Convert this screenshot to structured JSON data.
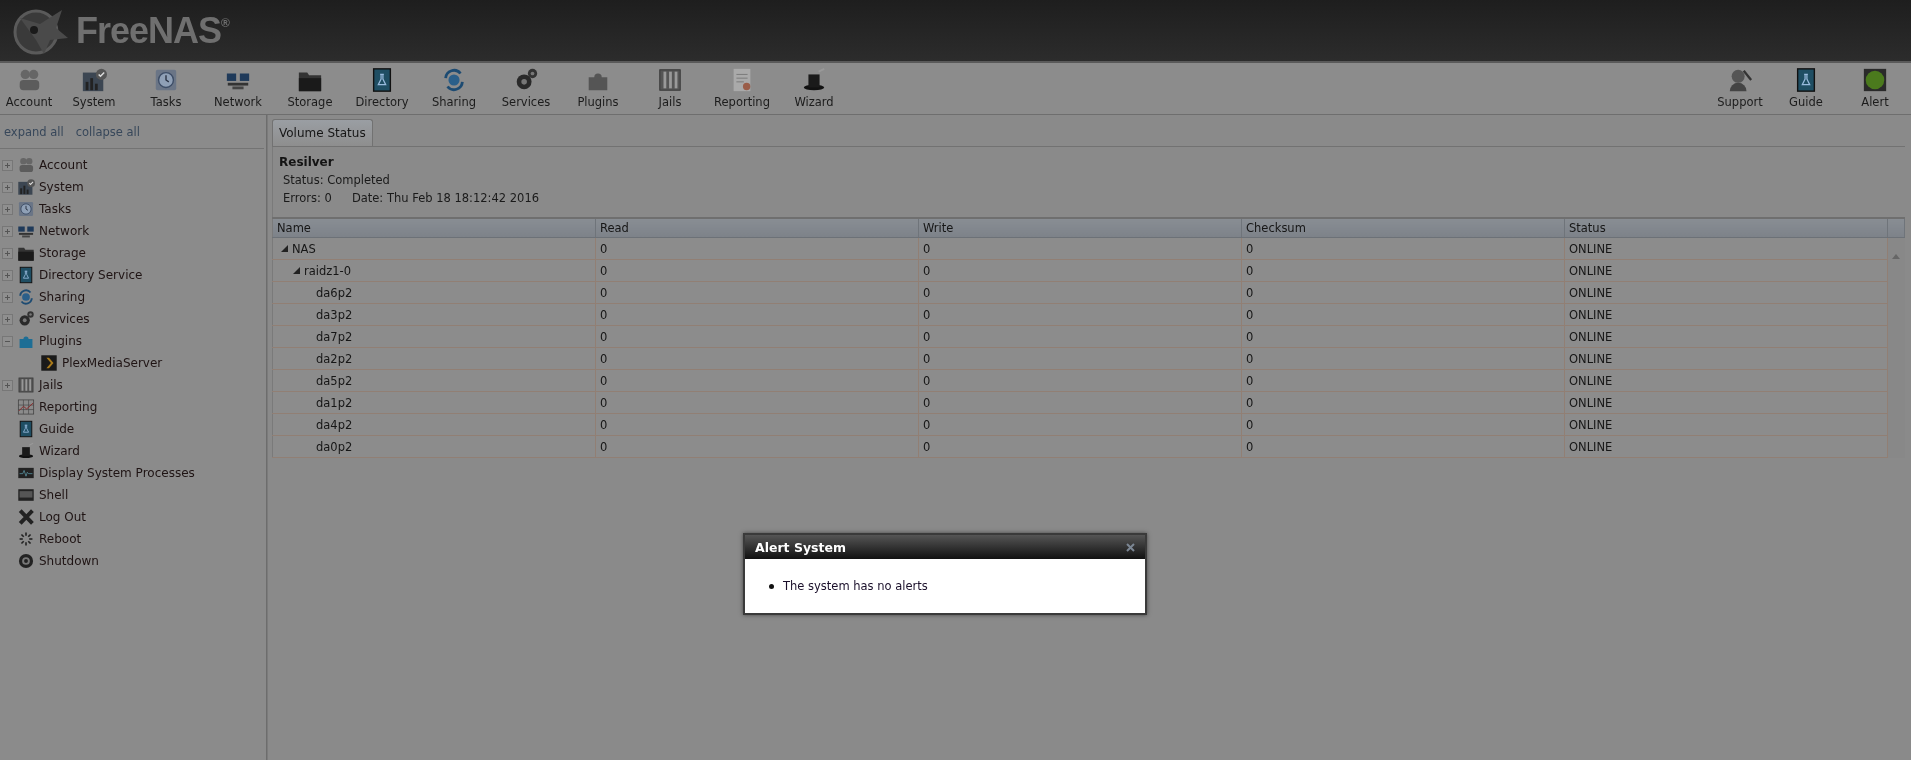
{
  "header": {
    "logo": "FreeNAS$^{®}$"
  },
  "toolbar": {
    "left": [
      "Account",
      "System",
      "Tasks",
      "Network",
      "Storage",
      "Directory",
      "Sharing",
      "Services",
      "Plugins",
      "Jails",
      "Reporting",
      "Wizard"
    ],
    "right": [
      "Support",
      "Guide",
      "Alert"
    ]
  },
  "sidebar": {
    "links": [
      "expand all",
      "collapse all"
    ],
    "items": [
      {
        "label": "Account",
        "expanded": false
      },
      {
        "label": "System",
        "expanded": false
      },
      {
        "label": "Tasks",
        "expanded": false
      },
      {
        "label": "Network",
        "expanded": false
      },
      {
        "label": "Storage",
        "expanded": false
      },
      {
        "label": "Directory Service",
        "expanded": false
      },
      {
        "label": "Sharing",
        "expanded": false
      },
      {
        "label": "Services",
        "expanded": false
      },
      {
        "label": "Plugins",
        "expanded": true,
        "children": [
          {
            "label": "PlexMediaServer"
          }
        ]
      },
      {
        "label": "Jails",
        "expanded": false
      },
      {
        "label": "Reporting"
      },
      {
        "label": "Guide"
      },
      {
        "label": "Wizard"
      },
      {
        "label": "Display System Processes"
      },
      {
        "label": "Shell"
      },
      {
        "label": "Log Out"
      },
      {
        "label": "Reboot"
      },
      {
        "label": "Shutdown"
      }
    ]
  },
  "tabs": [
    {
      "label": "Volume Status",
      "selected": true
    }
  ],
  "resilver": {
    "title": "Resilver",
    "status": "Status: Completed",
    "errors": "Errors: 0",
    "date": "Date: Thu Feb 18 18:12:42 2016"
  },
  "table": {
    "columns": [
      "Name",
      "Read",
      "Write",
      "Checksum",
      "Status"
    ],
    "rows": [
      {
        "cells": [
          "NAS",
          "0",
          "0",
          "0",
          "ONLINE"
        ],
        "expanded": true,
        "children": [
          {
            "cells": [
              "raidz1-0",
              "0",
              "0",
              "0",
              "ONLINE"
            ],
            "expanded": true,
            "children": [
              {
                "cells": [
                  "da6p2",
                  "0",
                  "0",
                  "0",
                  "ONLINE"
                ]
              },
              {
                "cells": [
                  "da3p2",
                  "0",
                  "0",
                  "0",
                  "ONLINE"
                ]
              },
              {
                "cells": [
                  "da7p2",
                  "0",
                  "0",
                  "0",
                  "ONLINE"
                ]
              },
              {
                "cells": [
                  "da2p2",
                  "0",
                  "0",
                  "0",
                  "ONLINE"
                ]
              },
              {
                "cells": [
                  "da5p2",
                  "0",
                  "0",
                  "0",
                  "ONLINE"
                ]
              },
              {
                "cells": [
                  "da1p2",
                  "0",
                  "0",
                  "0",
                  "ONLINE"
                ]
              },
              {
                "cells": [
                  "da4p2",
                  "0",
                  "0",
                  "0",
                  "ONLINE"
                ]
              },
              {
                "cells": [
                  "da0p2",
                  "0",
                  "0",
                  "0",
                  "ONLINE"
                ]
              }
            ]
          }
        ]
      }
    ]
  },
  "dialog": {
    "title": "Alert System",
    "items": [
      "The system has no alerts"
    ]
  }
}
